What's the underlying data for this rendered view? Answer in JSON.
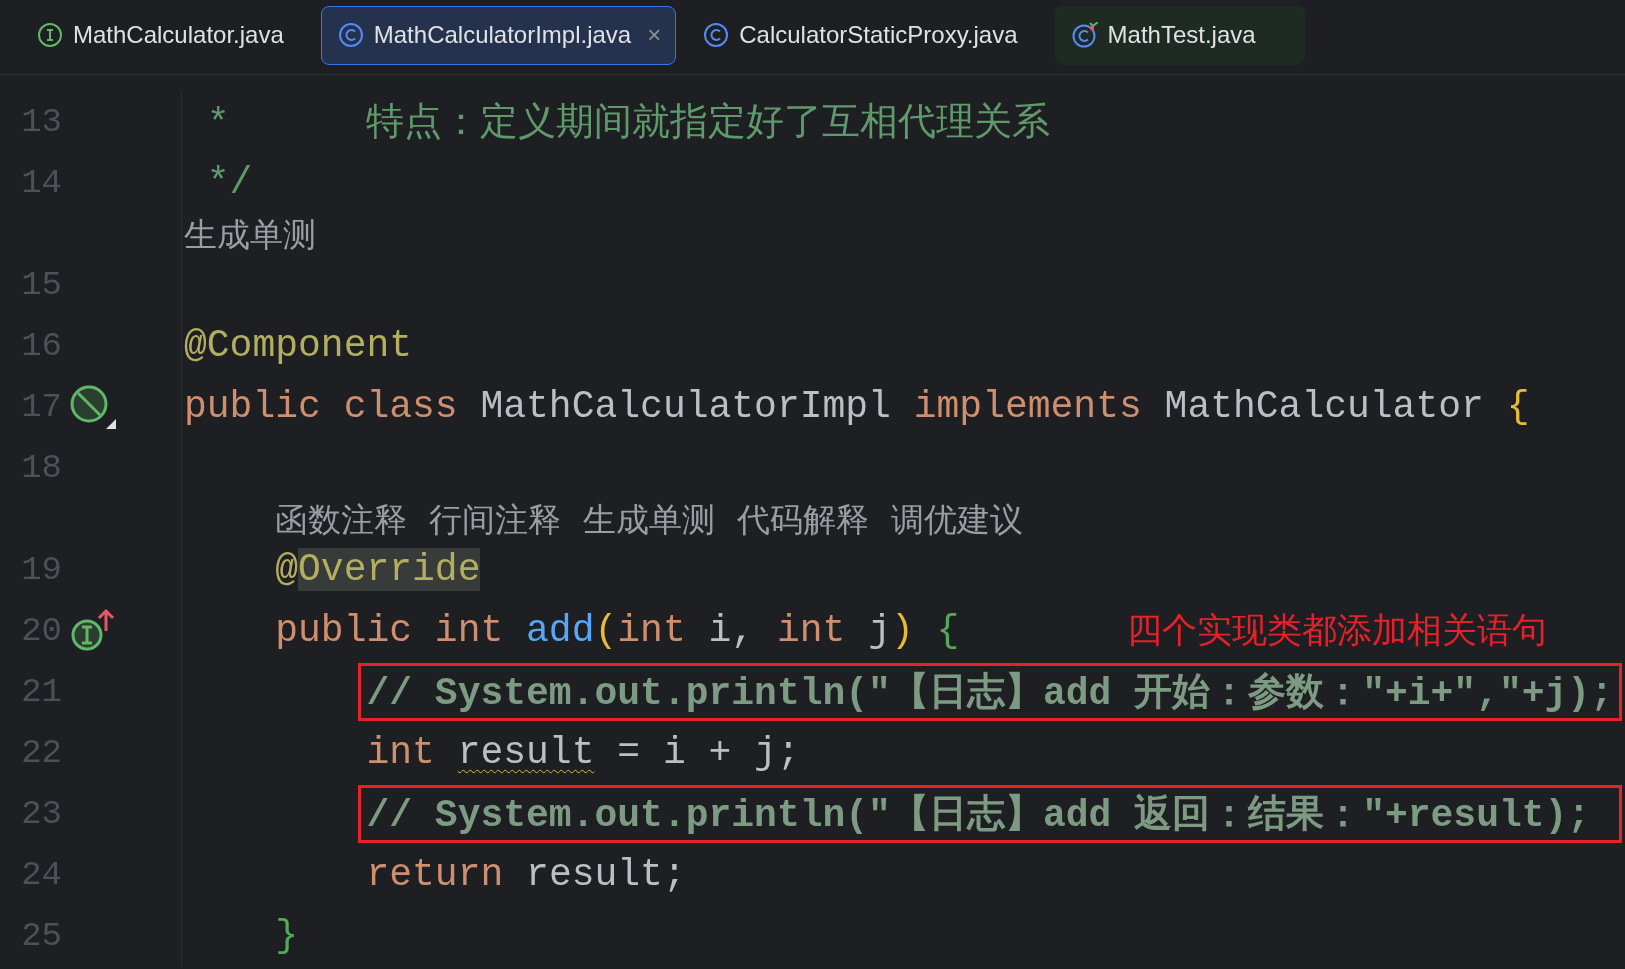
{
  "tabs": [
    {
      "label": "MathCalculator.java",
      "selected": false,
      "kind": "interface"
    },
    {
      "label": "MathCalculatorImpl.java",
      "selected": true,
      "close": "×",
      "kind": "class"
    },
    {
      "label": "CalculatorStaticProxy.java",
      "selected": false,
      "kind": "class"
    },
    {
      "label": "MathTest.java",
      "selected": false,
      "kind": "test"
    }
  ],
  "rows": [
    {
      "kind": "code",
      "number": "13",
      "tokens": [
        {
          "text": " *      特点：定义期间就指定好了互相代理关系",
          "kind": "doc"
        }
      ]
    },
    {
      "kind": "code",
      "number": "14",
      "tokens": [
        {
          "text": " */",
          "kind": "doc"
        }
      ]
    },
    {
      "kind": "hint",
      "indent": "",
      "actions": [
        "生成单测"
      ]
    },
    {
      "kind": "code",
      "number": "15",
      "tokens": []
    },
    {
      "kind": "code",
      "number": "16",
      "tokens": [
        {
          "text": "@Component",
          "kind": "annotation"
        }
      ]
    },
    {
      "kind": "declaration",
      "number": "17",
      "tokens": [
        {
          "text": "public class ",
          "kind": "keyword"
        },
        {
          "text": "MathCalculatorImpl ",
          "kind": "plain"
        },
        {
          "text": "implements ",
          "kind": "keyword"
        },
        {
          "text": "MathCalculator ",
          "kind": "plain"
        },
        {
          "text": "{",
          "kind": "paren"
        }
      ]
    },
    {
      "kind": "code",
      "number": "18",
      "tokens": []
    },
    {
      "kind": "hint",
      "indent": "    ",
      "actions": [
        "函数注释",
        "行间注释",
        "生成单测",
        "代码解释",
        "调优建议"
      ]
    },
    {
      "kind": "code",
      "number": "19",
      "indent": "    ",
      "tokens": [
        {
          "text": "@",
          "kind": "annotation"
        },
        {
          "text": "Override",
          "kind": "match"
        }
      ]
    },
    {
      "kind": "implementation",
      "number": "20",
      "indent": "    ",
      "tokens": [
        {
          "text": "public int ",
          "kind": "keyword"
        },
        {
          "text": "add",
          "kind": "method"
        },
        {
          "text": "(",
          "kind": "paren"
        },
        {
          "text": "int ",
          "kind": "keyword"
        },
        {
          "text": "i, ",
          "kind": "plain"
        },
        {
          "text": "int ",
          "kind": "keyword"
        },
        {
          "text": "j",
          "kind": "plain"
        },
        {
          "text": ") ",
          "kind": "paren"
        },
        {
          "text": "{",
          "kind": "brace"
        }
      ],
      "note": "四个实现类都添加相关语句"
    },
    {
      "kind": "code",
      "number": "21",
      "indent": "        ",
      "boxed": true,
      "tokens": [
        {
          "text": "// System.out.println(\"【日志】add 开始：参数：\"+i+\",\"+j);",
          "kind": "comment"
        }
      ]
    },
    {
      "kind": "code",
      "number": "22",
      "indent": "        ",
      "tokens": [
        {
          "text": "int ",
          "kind": "keyword"
        },
        {
          "text": "result",
          "kind": "warned"
        },
        {
          "text": " = i + j;",
          "kind": "plain"
        }
      ]
    },
    {
      "kind": "code",
      "number": "23",
      "indent": "        ",
      "boxed": true,
      "tokens": [
        {
          "text": "// System.out.println(\"【日志】add 返回：结果：\"+result);",
          "kind": "comment"
        }
      ]
    },
    {
      "kind": "code",
      "number": "24",
      "indent": "        ",
      "tokens": [
        {
          "text": "return ",
          "kind": "keyword"
        },
        {
          "text": "result;",
          "kind": "plain"
        }
      ]
    },
    {
      "kind": "code",
      "number": "25",
      "indent": "    ",
      "tokens": [
        {
          "text": "}",
          "kind": "brace"
        }
      ]
    }
  ]
}
